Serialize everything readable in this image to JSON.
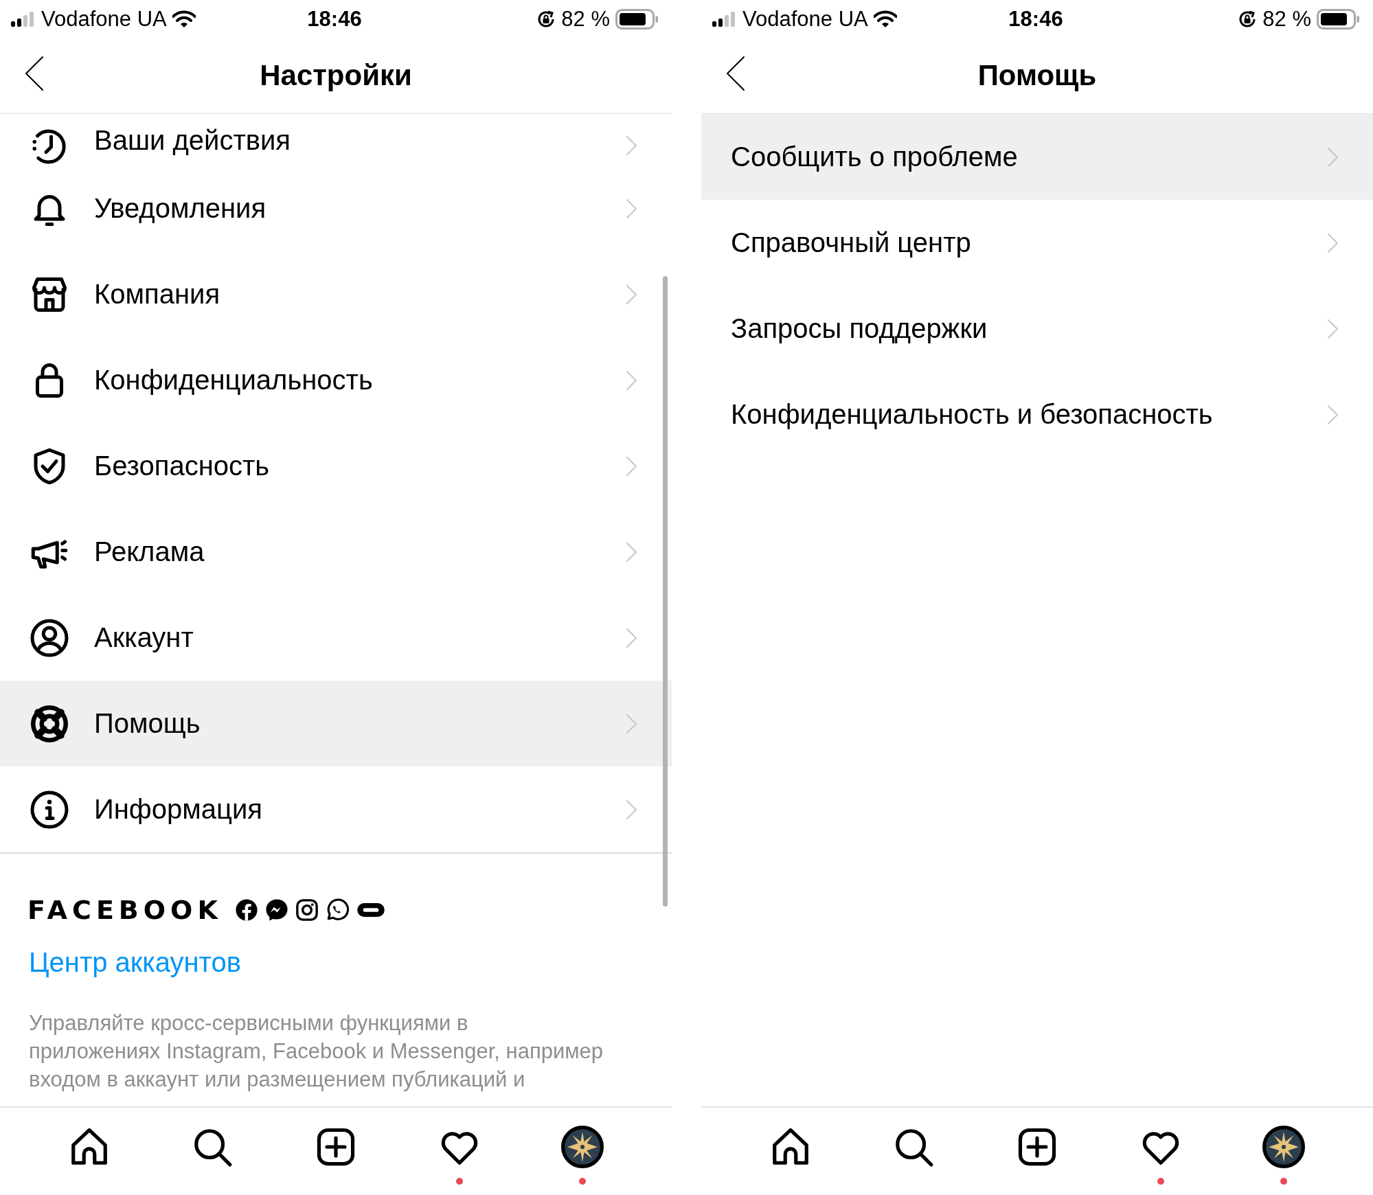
{
  "screens": [
    {
      "status_bar": {
        "carrier": "Vodafone UA",
        "time": "18:46",
        "battery": "82 %"
      },
      "header": {
        "title": "Настройки"
      },
      "scroll_bar": true,
      "menu": [
        {
          "label": "Ваши действия",
          "kind": "activity",
          "selected": false,
          "cut_off": true
        },
        {
          "label": "Уведомления",
          "kind": "bell",
          "selected": false
        },
        {
          "label": "Компания",
          "kind": "shop",
          "selected": false
        },
        {
          "label": "Конфиденциальность",
          "kind": "lock",
          "selected": false
        },
        {
          "label": "Безопасность",
          "kind": "shield",
          "selected": false
        },
        {
          "label": "Реклама",
          "kind": "megaphone",
          "selected": false
        },
        {
          "label": "Аккаунт",
          "kind": "account",
          "selected": false
        },
        {
          "label": "Помощь",
          "kind": "help",
          "selected": true
        },
        {
          "label": "Информация",
          "kind": "info",
          "selected": false
        }
      ],
      "footer": {
        "brand": "FACEBOOK",
        "link": "Центр аккаунтов",
        "description": [
          "Управляйте кросс-сервисными функциями в",
          "приложениях Instagram, Facebook и Messenger, например",
          "входом в аккаунт или размещением публикаций и"
        ]
      },
      "tab_bar": [
        {
          "kind": "home",
          "notification": false
        },
        {
          "kind": "search",
          "notification": false
        },
        {
          "kind": "new-post",
          "notification": false
        },
        {
          "kind": "activity",
          "notification": true
        },
        {
          "kind": "profile",
          "notification": true
        }
      ]
    },
    {
      "status_bar": {
        "carrier": "Vodafone UA",
        "time": "18:46",
        "battery": "82 %"
      },
      "header": {
        "title": "Помощь"
      },
      "menu": [
        {
          "label": "Сообщить о проблеме",
          "selected": true
        },
        {
          "label": "Справочный центр",
          "selected": false
        },
        {
          "label": "Запросы поддержки",
          "selected": false
        },
        {
          "label": "Конфиденциальность и безопасность",
          "selected": false
        }
      ],
      "tab_bar": [
        {
          "kind": "home",
          "notification": false
        },
        {
          "kind": "search",
          "notification": false
        },
        {
          "kind": "new-post",
          "notification": false
        },
        {
          "kind": "activity",
          "notification": true
        },
        {
          "kind": "profile",
          "notification": true
        }
      ]
    }
  ]
}
